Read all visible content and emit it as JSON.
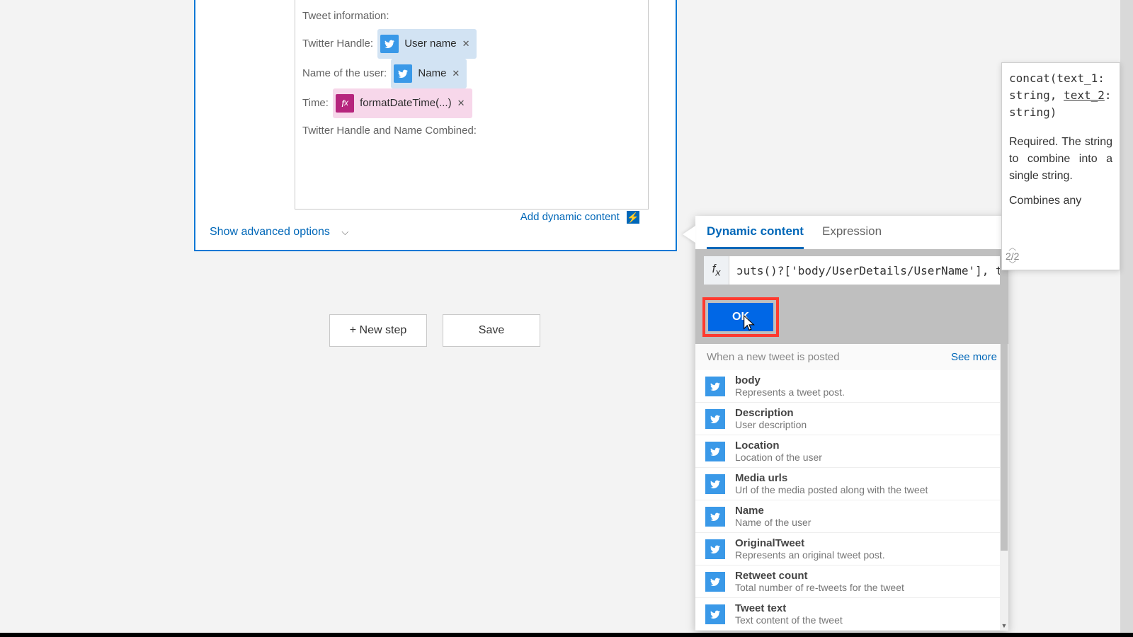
{
  "card": {
    "header_partial": "Tweet information:",
    "fields": {
      "handle_label": "Twitter Handle: ",
      "handle_token": "User name",
      "name_label": "Name of the user: ",
      "name_token": "Name",
      "time_label": "Time: ",
      "time_token": "formatDateTime(...)",
      "combined_label": "Twitter Handle and Name Combined:"
    },
    "add_dynamic": "Add dynamic content",
    "advanced": "Show advanced options"
  },
  "footer": {
    "new_step": "+ New step",
    "save": "Save"
  },
  "dc": {
    "tab_dynamic": "Dynamic content",
    "tab_expression": "Expression",
    "expression_text": "ɔuts()?['body/UserDetails/UserName'], trig",
    "ok": "OK",
    "group_title": "When a new tweet is posted",
    "see_more": "See more",
    "items": [
      {
        "title": "body",
        "desc": "Represents a tweet post."
      },
      {
        "title": "Description",
        "desc": "User description"
      },
      {
        "title": "Location",
        "desc": "Location of the user"
      },
      {
        "title": "Media urls",
        "desc": "Url of the media posted along with the tweet"
      },
      {
        "title": "Name",
        "desc": "Name of the user"
      },
      {
        "title": "OriginalTweet",
        "desc": "Represents an original tweet post."
      },
      {
        "title": "Retweet count",
        "desc": "Total number of re-tweets for the tweet"
      },
      {
        "title": "Tweet text",
        "desc": "Text content of the tweet"
      }
    ]
  },
  "hint": {
    "sig_pre": "concat(text_1: string, ",
    "sig_current": "text_2",
    "sig_post": ": string)",
    "paragraph": "Required. The string to combine into a single string.",
    "more": "Combines  any",
    "page": "2/2"
  }
}
